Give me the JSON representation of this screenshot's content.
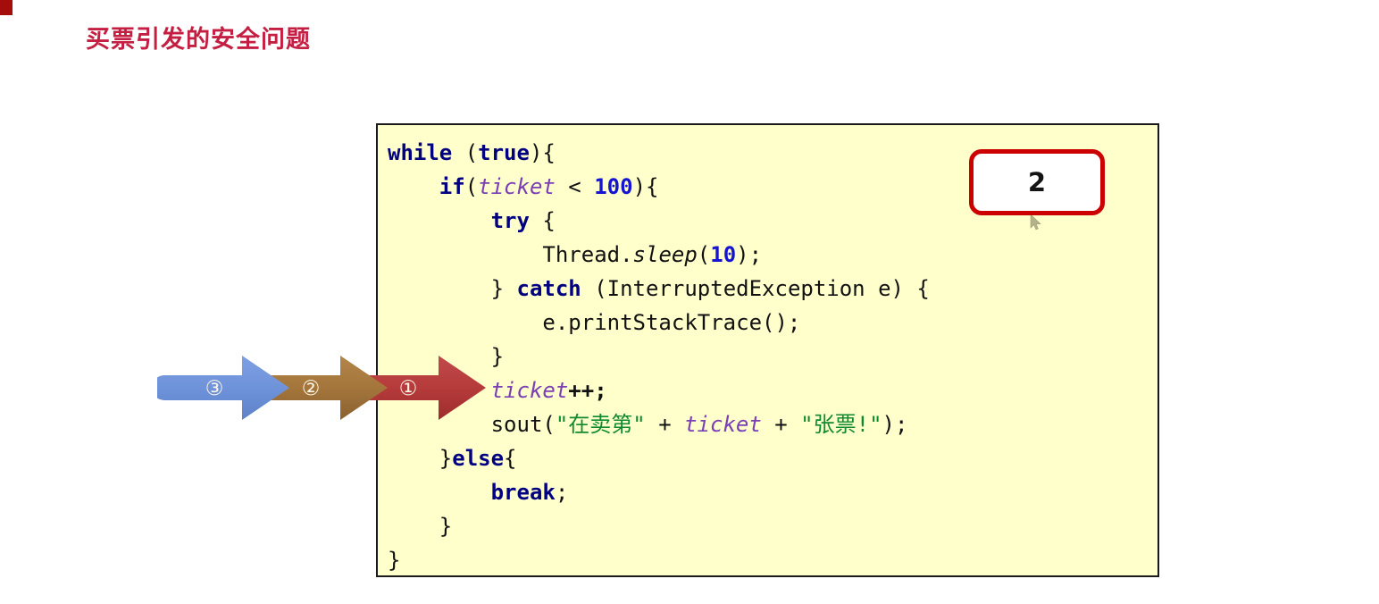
{
  "slide": {
    "title": "买票引发的安全问题",
    "title_color": "#c41f42",
    "corner_marker_color": "#a50d0d",
    "background_color": "#ffffff"
  },
  "code_panel": {
    "background_color": "#ffffcc",
    "border_color": "#1a1a1a",
    "language": "java",
    "plain_text": "while (true){\n    if(ticket < 100){\n        try {\n            Thread.sleep(10);\n        } catch (InterruptedException e) {\n            e.printStackTrace();\n        }\n        ticket++;\n        sout(\"在卖第\" + ticket + \"张票!\");\n    }else{\n        break;\n    }\n}",
    "lines": [
      {
        "indent": 0,
        "tokens": [
          {
            "t": "while",
            "c": "kw"
          },
          {
            "t": " (",
            "c": "plain"
          },
          {
            "t": "true",
            "c": "kw"
          },
          {
            "t": "){",
            "c": "plain"
          }
        ]
      },
      {
        "indent": 1,
        "tokens": [
          {
            "t": "if",
            "c": "kw"
          },
          {
            "t": "(",
            "c": "plain"
          },
          {
            "t": "ticket",
            "c": "var"
          },
          {
            "t": " < ",
            "c": "plain"
          },
          {
            "t": "100",
            "c": "num"
          },
          {
            "t": "){",
            "c": "plain"
          }
        ]
      },
      {
        "indent": 2,
        "tokens": [
          {
            "t": "try",
            "c": "kw"
          },
          {
            "t": " {",
            "c": "plain"
          }
        ]
      },
      {
        "indent": 3,
        "tokens": [
          {
            "t": "Thread.",
            "c": "plain"
          },
          {
            "t": "sleep",
            "c": "italic"
          },
          {
            "t": "(",
            "c": "plain"
          },
          {
            "t": "10",
            "c": "num"
          },
          {
            "t": ");",
            "c": "plain"
          }
        ]
      },
      {
        "indent": 2,
        "tokens": [
          {
            "t": "} ",
            "c": "plain"
          },
          {
            "t": "catch",
            "c": "kw"
          },
          {
            "t": " (InterruptedException e) {",
            "c": "plain"
          }
        ]
      },
      {
        "indent": 3,
        "tokens": [
          {
            "t": "e.printStackTrace();",
            "c": "plain"
          }
        ]
      },
      {
        "indent": 2,
        "tokens": [
          {
            "t": "}",
            "c": "plain"
          }
        ]
      },
      {
        "indent": 2,
        "tokens": [
          {
            "t": "ticket",
            "c": "var"
          },
          {
            "t": "++;",
            "c": "bold"
          }
        ]
      },
      {
        "indent": 2,
        "tokens": [
          {
            "t": "sout(",
            "c": "plain"
          },
          {
            "t": "\"在卖第\"",
            "c": "str"
          },
          {
            "t": " + ",
            "c": "plain"
          },
          {
            "t": "ticket",
            "c": "var"
          },
          {
            "t": " + ",
            "c": "plain"
          },
          {
            "t": "\"张票!\"",
            "c": "str"
          },
          {
            "t": ");",
            "c": "plain"
          }
        ]
      },
      {
        "indent": 1,
        "tokens": [
          {
            "t": "}",
            "c": "plain"
          },
          {
            "t": "else",
            "c": "kw"
          },
          {
            "t": "{",
            "c": "plain"
          }
        ]
      },
      {
        "indent": 2,
        "tokens": [
          {
            "t": "break",
            "c": "kw"
          },
          {
            "t": ";",
            "c": "plain"
          }
        ]
      },
      {
        "indent": 1,
        "tokens": [
          {
            "t": "}",
            "c": "plain"
          }
        ]
      },
      {
        "indent": 0,
        "tokens": [
          {
            "t": "}",
            "c": "plain"
          }
        ]
      }
    ]
  },
  "step_badge": {
    "value": "2",
    "border_color": "#cc0000",
    "fill_color": "#ffffff"
  },
  "arrows": [
    {
      "id": "arrow-3",
      "label": "③",
      "color": "#6f93da",
      "color_dark": "#5c80c9",
      "order": 3
    },
    {
      "id": "arrow-2",
      "label": "②",
      "color": "#a4763c",
      "color_dark": "#8e6330",
      "order": 2
    },
    {
      "id": "arrow-1",
      "label": "①",
      "color": "#b63b3b",
      "color_dark": "#a83030",
      "order": 1
    }
  ],
  "cursor": {
    "icon": "mouse-pointer-icon"
  }
}
